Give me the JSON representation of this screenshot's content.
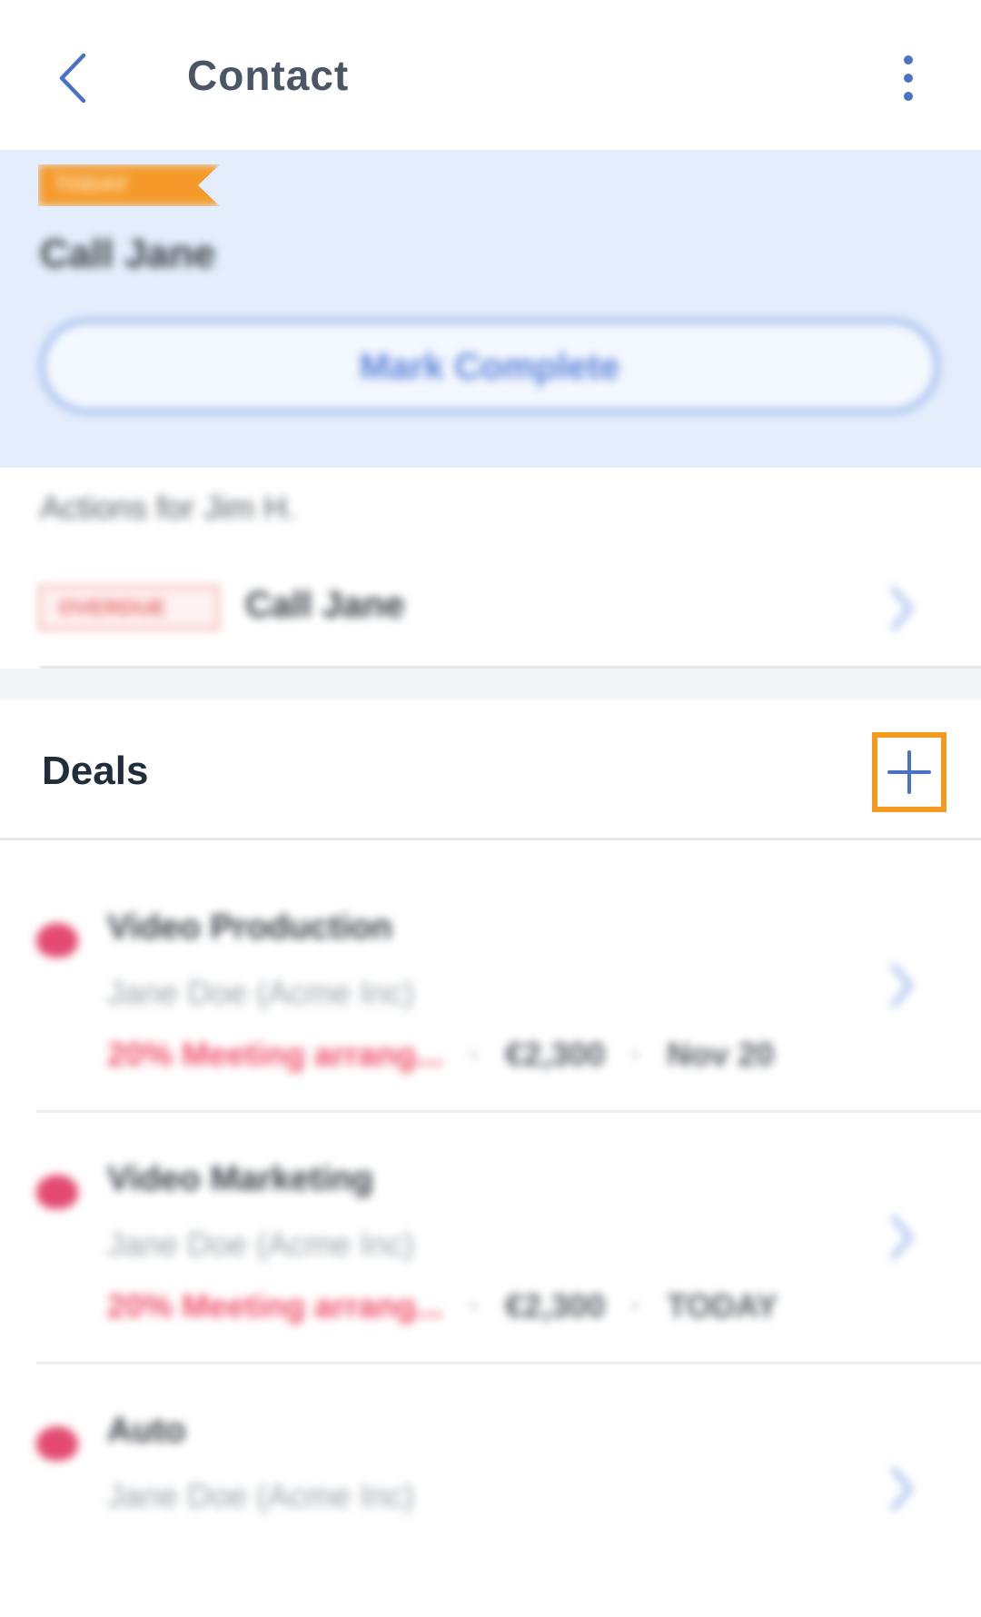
{
  "header": {
    "title": "Contact",
    "back_icon": "chevron-left-icon",
    "more_icon": "more-vertical-icon"
  },
  "task": {
    "due_label": "TODAY",
    "title": "Call Jane",
    "mark_complete_label": "Mark Complete"
  },
  "actions": {
    "label": "Actions for Jim H.",
    "items": [
      {
        "tag": "OVERDUE",
        "title": "Call Jane"
      }
    ]
  },
  "deals": {
    "title": "Deals",
    "add_icon": "plus-icon",
    "items": [
      {
        "name": "Video Production",
        "person": "Jane Doe (Acme Inc)",
        "stage": "20% Meeting arrang...",
        "amount": "€2,300",
        "date": "Nov 20"
      },
      {
        "name": "Video Marketing",
        "person": "Jane Doe (Acme Inc)",
        "stage": "20% Meeting arrang...",
        "amount": "€2,300",
        "date": "TODAY"
      },
      {
        "name": "Auto",
        "person": "Jane Doe (Acme Inc)",
        "stage": "",
        "amount": "",
        "date": ""
      }
    ]
  },
  "colors": {
    "accent": "#4a72c4",
    "highlight": "#f39a1f",
    "card_bg": "#e3edfc",
    "stage_red": "#ef4f6a"
  }
}
